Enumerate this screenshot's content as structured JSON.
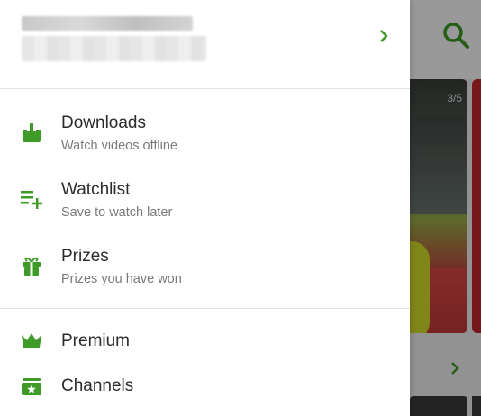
{
  "colors": {
    "accent": "#3e9b27",
    "text": "#2b2b2b",
    "subtext": "#7a7a7a"
  },
  "background": {
    "carousel_counter": "3/5",
    "icons": [
      "search-icon",
      "chevron-right-icon"
    ]
  },
  "drawer": {
    "profile": {
      "chevron_icon": "chevron-right-icon"
    },
    "items": [
      {
        "label": "Downloads",
        "sublabel": "Watch videos offline",
        "icon": "download-icon"
      },
      {
        "label": "Watchlist",
        "sublabel": "Save to watch later",
        "icon": "playlist-add-icon"
      },
      {
        "label": "Prizes",
        "sublabel": "Prizes you have won",
        "icon": "gift-icon"
      },
      {
        "label": "Premium",
        "icon": "crown-icon"
      },
      {
        "label": "Channels",
        "icon": "channels-icon"
      }
    ]
  }
}
